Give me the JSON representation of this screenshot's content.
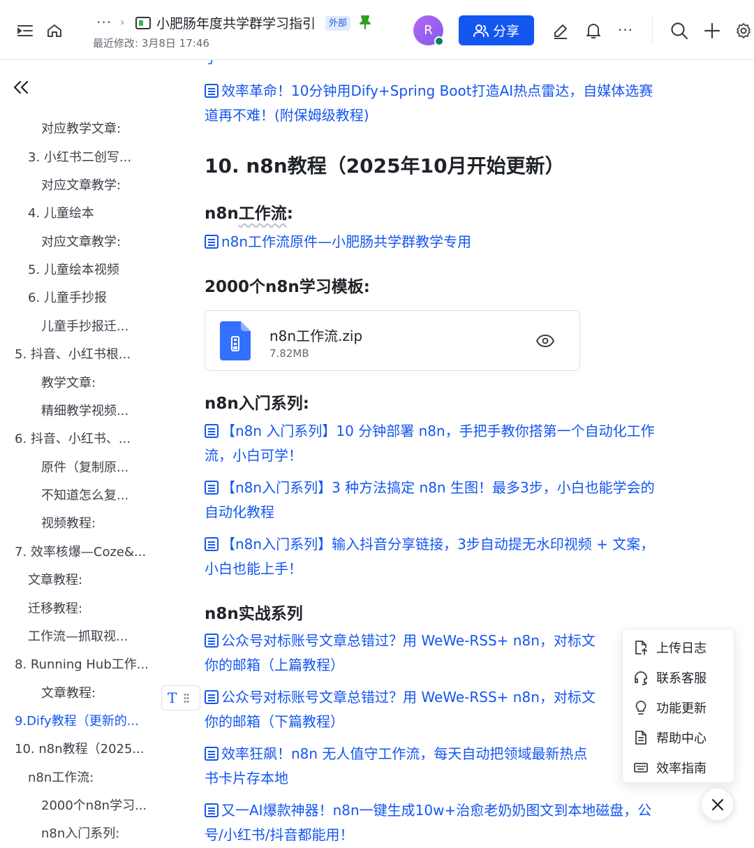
{
  "header": {
    "breadcrumb_more": "···",
    "breadcrumb_sep": "›",
    "doc_title": "小肥肠年度共学群学习指引",
    "external_badge": "外部",
    "last_modified": "最近修改: 3月8日 17:46",
    "avatar_letter": "R",
    "share_label": "分享",
    "more_label": "···"
  },
  "sidebar": {
    "items": [
      {
        "label": "对应教学文章:"
      },
      {
        "label": "3. 小红书二创写..."
      },
      {
        "label": "对应文章教学:"
      },
      {
        "label": "4. 儿童绘本"
      },
      {
        "label": "对应文章教学:"
      },
      {
        "label": "5. 儿童绘本视频"
      },
      {
        "label": "6. 儿童手抄报"
      },
      {
        "label": "儿童手抄报迁..."
      },
      {
        "label": "5. 抖音、小红书根..."
      },
      {
        "label": "教学文章:"
      },
      {
        "label": "精细教学视频..."
      },
      {
        "label": "6. 抖音、小红书、..."
      },
      {
        "label": "原件（复制原..."
      },
      {
        "label": "不知道怎么复..."
      },
      {
        "label": "视频教程:"
      },
      {
        "label": "7. 效率核爆—Coze&..."
      },
      {
        "label": "文章教程:"
      },
      {
        "label": "迁移教程:"
      },
      {
        "label": "工作流—抓取视..."
      },
      {
        "label": "8. Running Hub工作..."
      },
      {
        "label": "文章教程:"
      },
      {
        "label": "9.Dify教程（更新的..."
      },
      {
        "label": "10. n8n教程（2025..."
      },
      {
        "label": "n8n工作流:"
      },
      {
        "label": "2000个n8n学习..."
      },
      {
        "label": "n8n入门系列:"
      }
    ]
  },
  "main": {
    "partial_top": "手",
    "link_dify_1": "效率革命！10分钟用Dify+Spring Boot打造AI热点雷达，自媒体选赛",
    "link_dify_2": "道再不难！(附保姆级教程)",
    "heading_10": "10. n8n教程（2025年10月开始更新）",
    "h_workflow_a": "n8n",
    "h_workflow_b": "工作流",
    "h_workflow_c": ":",
    "link_workflow": "n8n工作流原件—小肥肠共学群教学专用",
    "h_templates": "2000个n8n学习模板:",
    "file": {
      "name": "n8n工作流.zip",
      "size": "7.82MB"
    },
    "h_intro": "n8n入门系列:",
    "intro_1a": "【n8n 入门系列】10 分钟部署 n8n，手把手教你搭第一个自动化工作",
    "intro_1b": "流，小白可学！",
    "intro_2a": "【n8n入门系列】3 种方法搞定 n8n 生图！最多3步，小白也能学会的",
    "intro_2b": "自动化教程",
    "intro_3a": "【n8n入门系列】输入抖音分享链接，3步自动提无水印视频 + 文案，",
    "intro_3b": "小白也能上手！",
    "h_practice": "n8n实战系列",
    "prac_1a": "公众号对标账号文章总错过？用 WeWe-RSS+ n8n，对标文",
    "prac_1b": "你的邮箱（上篇教程）",
    "prac_2a": "公众号对标账号文章总错过？用 WeWe-RSS+ n8n，对标文",
    "prac_2b": "你的邮箱（下篇教程）",
    "prac_3a": "效率狂飙！n8n 无人值守工作流，每天自动把领域最新热点",
    "prac_3b": "书卡片存本地",
    "prac_4a": "又一AI爆款神器！n8n一键生成10w+治愈老奶奶图文到本地磁盘，公",
    "prac_4b": "号/小红书/抖音都能用！",
    "block_handle_T": "T"
  },
  "float_menu": {
    "items": [
      {
        "label": "上传日志",
        "icon": "upload-log-icon"
      },
      {
        "label": "联系客服",
        "icon": "headset-icon"
      },
      {
        "label": "功能更新",
        "icon": "lightbulb-icon"
      },
      {
        "label": "帮助中心",
        "icon": "help-doc-icon"
      },
      {
        "label": "效率指南",
        "icon": "keyboard-icon"
      }
    ]
  },
  "colors": {
    "accent": "#1456f0",
    "link": "#1456f0",
    "text": "#1f2329",
    "badge_bg": "#e1eaff",
    "pin": "#2ea121"
  }
}
